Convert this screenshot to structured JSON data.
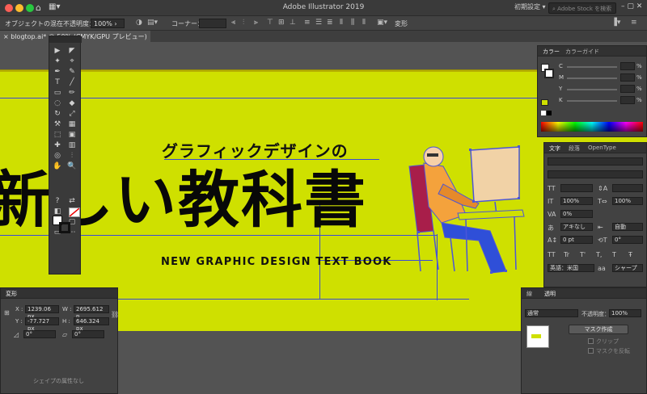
{
  "window": {
    "title": "Adobe Illustrator 2019",
    "workspace": "初期設定",
    "stock_search_placeholder": "Adobe Stock を検索",
    "traffic_colors": [
      "#fc5f57",
      "#fdbc2e",
      "#28c840"
    ]
  },
  "controlbar": {
    "selection_label": "オブジェクトの混在",
    "opacity_label": "不透明度：",
    "opacity_value": "100%",
    "corner_label": "コーナー：",
    "transform_label": "変形"
  },
  "document": {
    "tab_label": "blogtop.ai* @ 50% (CMYK/GPU プレビュー)",
    "close_icon": "×"
  },
  "artwork": {
    "subtitle": "グラフィックデザインの",
    "title": "新しい教科書",
    "english": "NEW GRAPHIC DESIGN TEXT BOOK",
    "background_color": "#cfe000"
  },
  "tools": {
    "items": [
      "▶",
      "◤",
      "✦",
      "⌖",
      "✒",
      "✎",
      "T",
      "╱",
      "▭",
      "✏",
      "◌",
      "◆",
      "↻",
      "⤢",
      "⚒",
      "▦",
      "⬚",
      "▣",
      "✚",
      "▥",
      "◎",
      "⫶",
      "✋",
      "🔍",
      "?",
      "⇄",
      "◧",
      "◨",
      "▤",
      "▢",
      "▭",
      "⋯"
    ]
  },
  "color_panel": {
    "tabs": [
      "カラー",
      "カラーガイド"
    ],
    "channels": [
      {
        "label": "C",
        "value": "",
        "unit": "%"
      },
      {
        "label": "M",
        "value": "",
        "unit": "%"
      },
      {
        "label": "Y",
        "value": "",
        "unit": "%"
      },
      {
        "label": "K",
        "value": "",
        "unit": "%"
      }
    ]
  },
  "type_panel": {
    "tabs": [
      "文字",
      "段落",
      "OpenType"
    ],
    "font_size": "",
    "leading_value": "100%",
    "h_scale": "100%",
    "tracking": "0%",
    "kerning": "アキなし",
    "auto_label": "自動",
    "baseline": "0 pt",
    "rotation": "0°",
    "language": "英語：米国",
    "sharpness": "シャープ",
    "styles": [
      "TT",
      "Tr",
      "T'",
      "T,",
      "T",
      "Ŧ"
    ]
  },
  "transform_panel": {
    "title": "変形",
    "x_label": "X :",
    "x_value": "1239.06 px",
    "y_label": "Y :",
    "y_value": "-77.727 px",
    "w_label": "W :",
    "w_value": "2695.612 p",
    "h_label": "H :",
    "h_value": "646.324 px",
    "angle_value": "0°",
    "shear_value": "0°",
    "footer": "シェイプの属性なし"
  },
  "transparency_panel": {
    "tabs": [
      "線",
      "透明"
    ],
    "blend_mode": "通常",
    "opacity_label": "不透明度：",
    "opacity_value": "100%",
    "mask_button": "マスク作成",
    "clip_label": "クリップ",
    "invert_label": "マスクを反転"
  }
}
